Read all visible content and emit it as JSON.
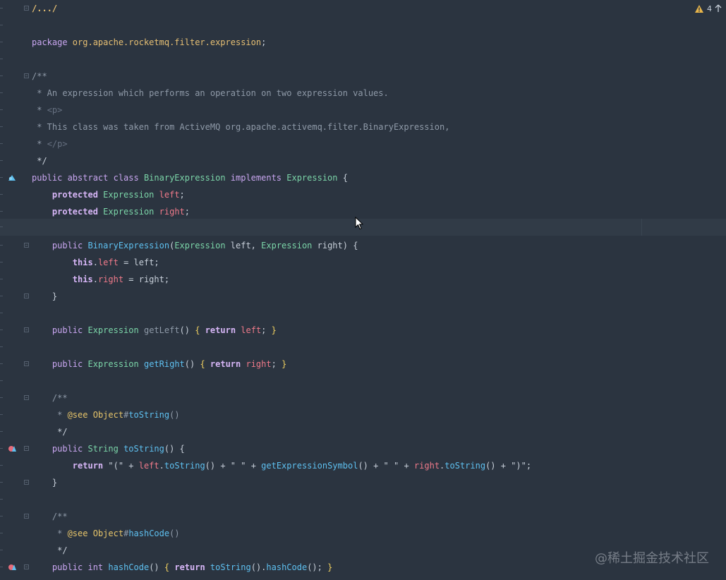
{
  "editor": {
    "folded_region": "/.../",
    "status": {
      "warning_count": "4"
    },
    "watermark": "@稀土掘金技术社区"
  },
  "code": {
    "l3": {
      "t1": "package ",
      "t2": "org.apache.rocketmq.filter.expression",
      "t3": ";"
    },
    "l5": {
      "t1": "/**"
    },
    "l6": {
      "t1": " * An expression which performs an operation on two expression values."
    },
    "l7": {
      "t1": " * ",
      "t2": "<p>"
    },
    "l8": {
      "t1": " * This class was taken from ActiveMQ org.apache.activemq.filter.BinaryExpression,"
    },
    "l9": {
      "t1": " * ",
      "t2": "</p>"
    },
    "l10": {
      "t1": " */"
    },
    "l11": {
      "t1": "public abstract class ",
      "t2": "BinaryExpression",
      "t3": " implements ",
      "t4": "Expression",
      "t5": " {"
    },
    "l12": {
      "t1": "    protected ",
      "t2": "Expression",
      "t3": " ",
      "t4": "left",
      "t5": ";"
    },
    "l13": {
      "t1": "    protected ",
      "t2": "Expression",
      "t3": " ",
      "t4": "right",
      "t5": ";"
    },
    "l15": {
      "t1": "    public ",
      "t2": "BinaryExpression",
      "t3": "(",
      "t4": "Expression",
      "t5": " left, ",
      "t6": "Expression",
      "t7": " right) {"
    },
    "l16": {
      "t1": "        this",
      "t2": ".",
      "t3": "left",
      "t4": " = left;"
    },
    "l17": {
      "t1": "        this",
      "t2": ".",
      "t3": "right",
      "t4": " = right;"
    },
    "l18": {
      "t1": "    }"
    },
    "l20": {
      "t1": "    public ",
      "t2": "Expression",
      "t3": " ",
      "t4": "getLeft",
      "t5": "() ",
      "t6": "{",
      "t7": " return ",
      "t8": "left",
      "t9": "; ",
      "t10": "}"
    },
    "l22": {
      "t1": "    public ",
      "t2": "Expression",
      "t3": " ",
      "t4": "getRight",
      "t5": "() ",
      "t6": "{",
      "t7": " return ",
      "t8": "right",
      "t9": "; ",
      "t10": "}"
    },
    "l24": {
      "t1": "    /**"
    },
    "l25": {
      "t1": "     * ",
      "t2": "@see",
      "t3": " ",
      "t4": "Object",
      "t5": "#",
      "t6": "toString",
      "t7": "()"
    },
    "l26": {
      "t1": "     */"
    },
    "l27": {
      "t1": "    public ",
      "t2": "String",
      "t3": " ",
      "t4": "toString",
      "t5": "() {"
    },
    "l28": {
      "t1": "        return ",
      "t2": "\"(\" + ",
      "t3": "left",
      "t4": ".",
      "t5": "toString",
      "t6": "() + \" \" + ",
      "t7": "getExpressionSymbol",
      "t8": "() + \" \" + ",
      "t9": "right",
      "t10": ".",
      "t11": "toString",
      "t12": "() + \")\";"
    },
    "l29": {
      "t1": "    }"
    },
    "l31": {
      "t1": "    /**"
    },
    "l32": {
      "t1": "     * ",
      "t2": "@see",
      "t3": " ",
      "t4": "Object",
      "t5": "#",
      "t6": "hashCode",
      "t7": "()"
    },
    "l33": {
      "t1": "     */"
    },
    "l34": {
      "t1": "    public ",
      "t2": "int",
      "t3": " ",
      "t4": "hashCode",
      "t5": "() ",
      "t6": "{",
      "t7": " return ",
      "t8": "toString",
      "t9": "().",
      "t10": "hashCode",
      "t11": "(); ",
      "t12": "}"
    }
  },
  "colors": {
    "background": "#2b3440",
    "keyword": "#c9a6f0",
    "class": "#7bd5a8",
    "function": "#5ec0f0",
    "field": "#f07a8a",
    "package": "#e6bf73",
    "comment": "#8f9aa8"
  },
  "icons": {
    "warning": "warning-triangle-icon",
    "navigate_up": "arrow-up-icon",
    "implementation_marker": "implemented-marker-icon",
    "override_marker": "override-marker-icon"
  }
}
